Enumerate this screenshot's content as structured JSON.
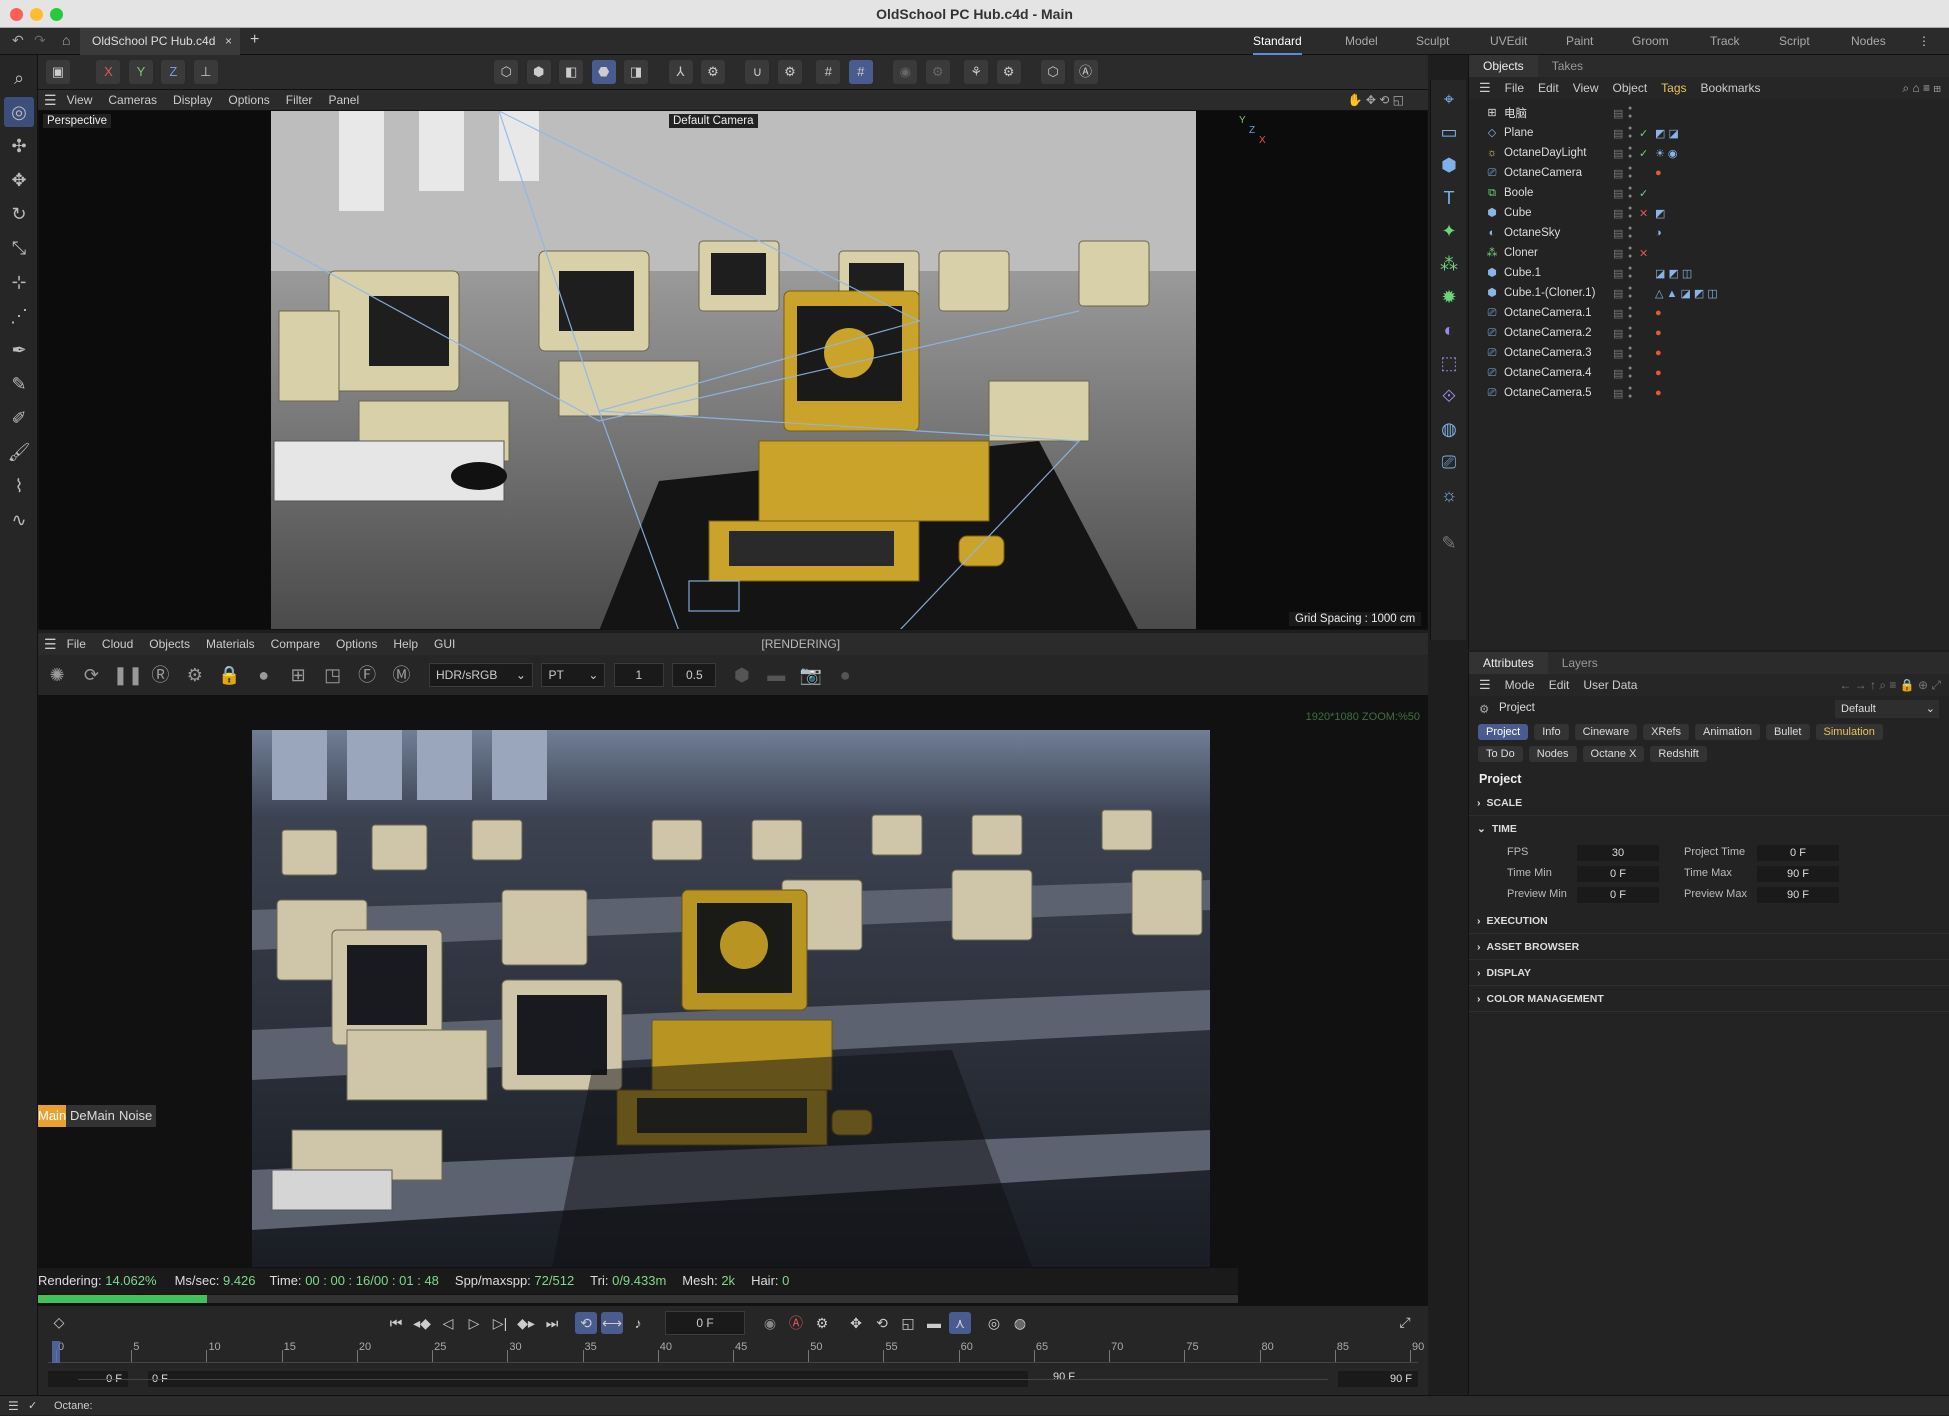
{
  "window": {
    "title": "OldSchool PC Hub.c4d - Main"
  },
  "tabs": {
    "doc": "OldSchool PC Hub.c4d",
    "close": "×",
    "add": "+"
  },
  "layouts": [
    "Standard",
    "Model",
    "Sculpt",
    "UVEdit",
    "Paint",
    "Groom",
    "Track",
    "Script",
    "Nodes"
  ],
  "viewport": {
    "menu": [
      "View",
      "Cameras",
      "Display",
      "Options",
      "Filter",
      "Panel"
    ],
    "label": "Perspective",
    "camera": "Default Camera",
    "grid": "Grid Spacing : 1000 cm",
    "axes": {
      "x": "X",
      "y": "Y",
      "z": "Z"
    }
  },
  "coord": {
    "x": "X",
    "y": "Y",
    "z": "Z"
  },
  "objects": {
    "tabs": [
      "Objects",
      "Takes"
    ],
    "menu": [
      "File",
      "Edit",
      "View",
      "Object",
      "Tags",
      "Bookmarks"
    ],
    "rows": [
      {
        "name": "电脑"
      },
      {
        "name": "Plane"
      },
      {
        "name": "OctaneDayLight"
      },
      {
        "name": "OctaneCamera"
      },
      {
        "name": "Boole"
      },
      {
        "name": "Cube"
      },
      {
        "name": "OctaneSky"
      },
      {
        "name": "Cloner"
      },
      {
        "name": "Cube.1"
      },
      {
        "name": "Cube.1-(Cloner.1)"
      },
      {
        "name": "OctaneCamera.1"
      },
      {
        "name": "OctaneCamera.2"
      },
      {
        "name": "OctaneCamera.3"
      },
      {
        "name": "OctaneCamera.4"
      },
      {
        "name": "OctaneCamera.5"
      }
    ]
  },
  "octane": {
    "menu": [
      "File",
      "Cloud",
      "Objects",
      "Materials",
      "Compare",
      "Options",
      "Help",
      "GUI"
    ],
    "state": "[RENDERING]",
    "colorspace": "HDR/sRGB",
    "kernel": "PT",
    "val1": "1",
    "val2": "0.5",
    "zoom": "1920*1080 ZOOM:%50",
    "passes": [
      "Main",
      "DeMain",
      "Noise"
    ],
    "status": {
      "rendering_label": "Rendering:",
      "rendering": "14.062%",
      "ms_label": "Ms/sec:",
      "ms": "9.426",
      "time_label": "Time:",
      "time": "00 : 00 : 16/00 : 01 : 48",
      "spp_label": "Spp/maxspp:",
      "spp": "72/512",
      "tri_label": "Tri:",
      "tri": "0/9.433m",
      "mesh_label": "Mesh:",
      "mesh": "2k",
      "hair_label": "Hair:",
      "hair": "0"
    },
    "progress": 0.14062
  },
  "timeline": {
    "frame": "0 F",
    "ticks": [
      "0",
      "5",
      "10",
      "15",
      "20",
      "25",
      "30",
      "35",
      "40",
      "45",
      "50",
      "55",
      "60",
      "65",
      "70",
      "75",
      "80",
      "85",
      "90"
    ],
    "start": "0 F",
    "start2": "0 F",
    "end": "90 F",
    "end2": "90 F"
  },
  "attributes": {
    "tabs": [
      "Attributes",
      "Layers"
    ],
    "menu": [
      "Mode",
      "Edit",
      "User Data"
    ],
    "object": "Project",
    "preset": "Default",
    "buttons1": [
      "Project",
      "Info",
      "Cineware",
      "XRefs",
      "Animation",
      "Bullet",
      "Simulation"
    ],
    "buttons2": [
      "To Do",
      "Nodes",
      "Octane X",
      "Redshift"
    ],
    "heading": "Project",
    "sections": {
      "scale": "SCALE",
      "time": "TIME",
      "execution": "EXECUTION",
      "asset": "ASSET BROWSER",
      "display": "DISPLAY",
      "color": "COLOR MANAGEMENT"
    },
    "time": {
      "fps_label": "FPS",
      "fps": "30",
      "ptime_label": "Project Time",
      "ptime": "0 F",
      "tmin_label": "Time Min",
      "tmin": "0 F",
      "tmax_label": "Time Max",
      "tmax": "90 F",
      "pmin_label": "Preview Min",
      "pmin": "0 F",
      "pmax_label": "Preview Max",
      "pmax": "90 F"
    }
  },
  "bottom": {
    "status": "Octane:"
  },
  "colors": {
    "accent": "#4a5c8f",
    "progress": "#42c05a",
    "yellow_pc": "#c9a32a"
  }
}
